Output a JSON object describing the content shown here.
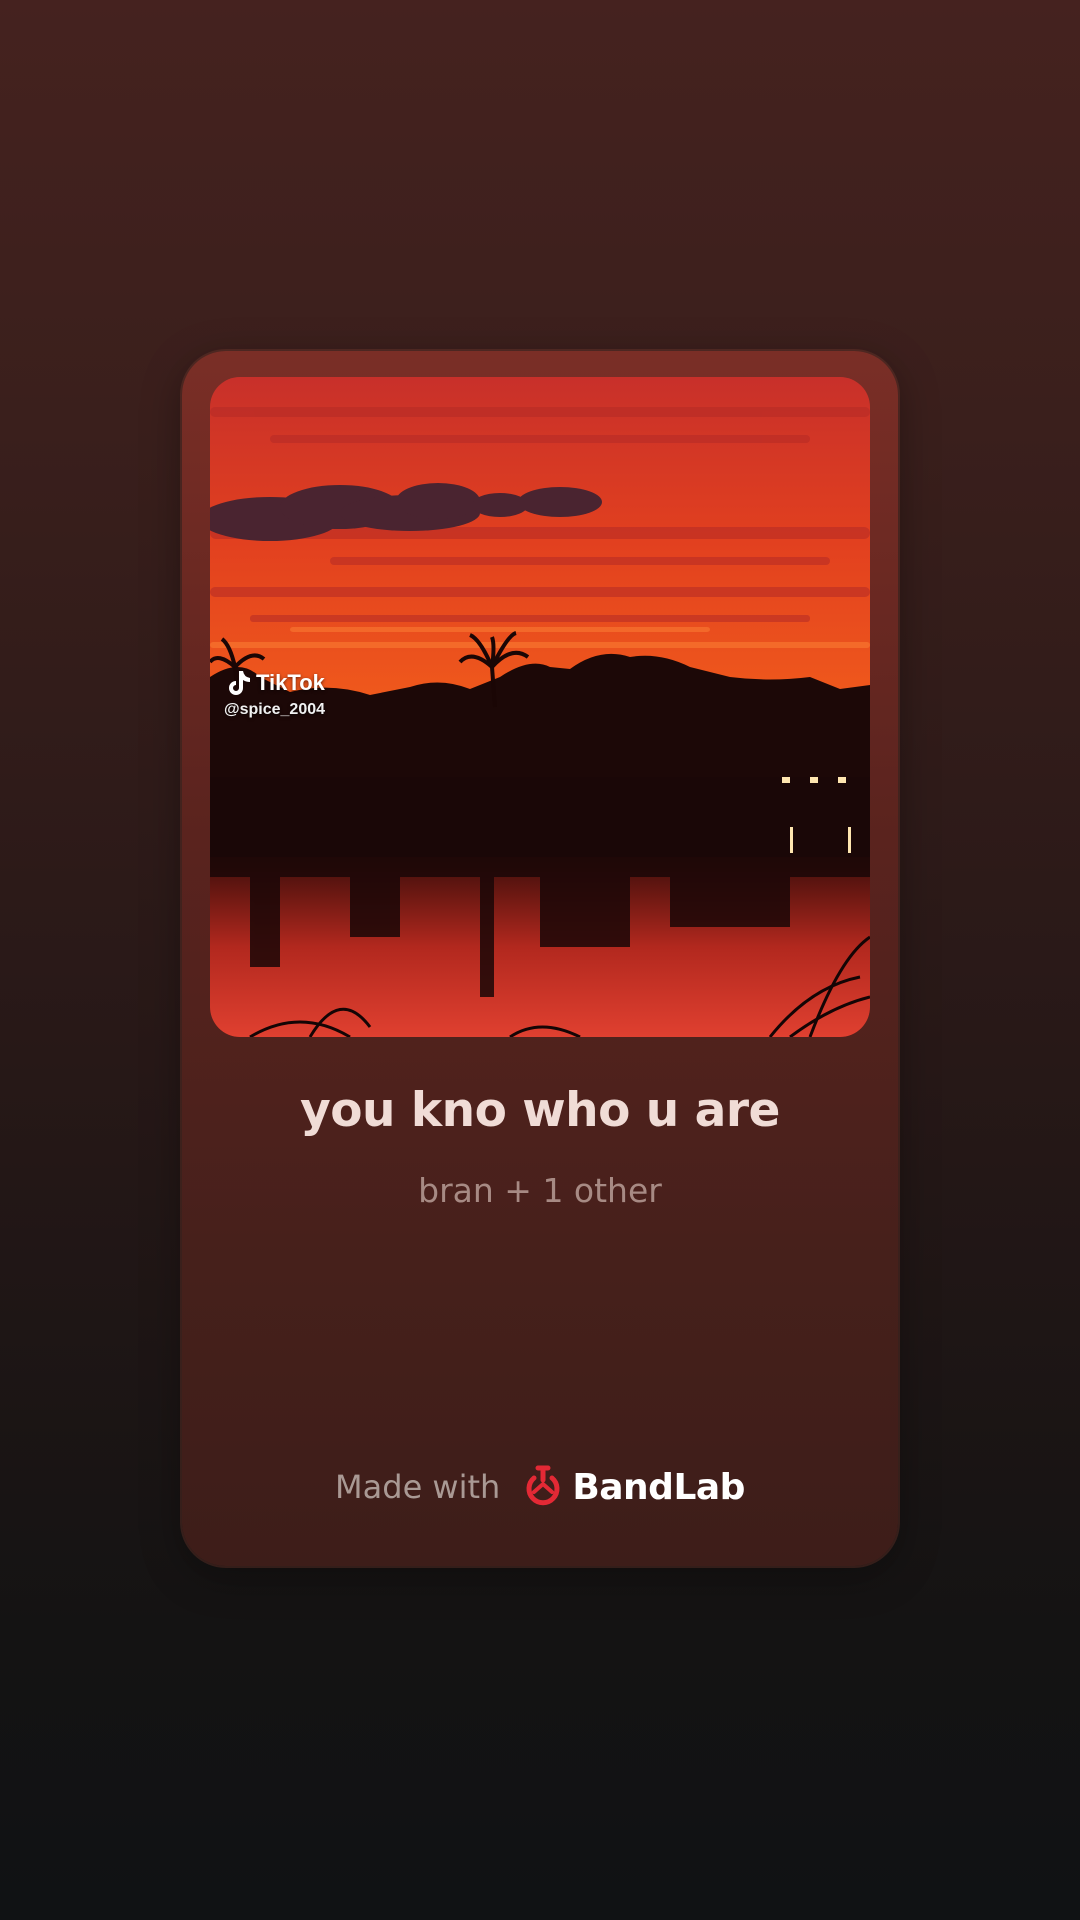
{
  "artwork": {
    "watermark": {
      "brand": "TikTok",
      "handle": "@spice_2004"
    }
  },
  "track": {
    "title": "you kno who u are",
    "artist": "bran + 1 other"
  },
  "footer": {
    "made_with": "Made with",
    "brand": "BandLab",
    "brand_color": "#e32935"
  },
  "icons": {
    "tiktok": "tiktok-note-icon",
    "bandlab": "bandlab-logo-icon"
  }
}
